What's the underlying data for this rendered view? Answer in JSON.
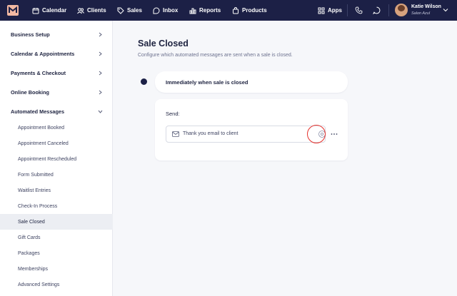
{
  "nav": {
    "items": [
      {
        "label": "Calendar",
        "icon": "calendar-icon"
      },
      {
        "label": "Clients",
        "icon": "clients-icon"
      },
      {
        "label": "Sales",
        "icon": "sales-tag-icon"
      },
      {
        "label": "Inbox",
        "icon": "inbox-icon"
      },
      {
        "label": "Reports",
        "icon": "reports-icon"
      },
      {
        "label": "Products",
        "icon": "products-bag-icon"
      }
    ],
    "apps_label": "Apps",
    "user": {
      "name": "Katie Wilson",
      "org": "Salon Azul"
    },
    "colors": {
      "bar": "#1c2046",
      "text": "#ffffff"
    }
  },
  "sidebar": {
    "sections": [
      {
        "label": "Business Setup"
      },
      {
        "label": "Calendar & Appointments"
      },
      {
        "label": "Payments & Checkout"
      },
      {
        "label": "Online Booking"
      },
      {
        "label": "Automated Messages"
      }
    ],
    "items": [
      {
        "label": "Appointment Booked"
      },
      {
        "label": "Appointment Canceled"
      },
      {
        "label": "Appointment Rescheduled"
      },
      {
        "label": "Form Submitted"
      },
      {
        "label": "Waitlist Entries"
      },
      {
        "label": "Check-In Process"
      },
      {
        "label": "Sale Closed",
        "active": true
      },
      {
        "label": "Gift Cards"
      },
      {
        "label": "Packages"
      },
      {
        "label": "Memberships"
      },
      {
        "label": "Advanced Settings"
      }
    ]
  },
  "main": {
    "title": "Sale Closed",
    "description": "Configure which automated messages are sent when a sale is closed.",
    "trigger_label": "Immediately when sale is closed",
    "send_label": "Send:",
    "message_name": "Thank you email to client",
    "highlight_color": "#e5322d"
  }
}
